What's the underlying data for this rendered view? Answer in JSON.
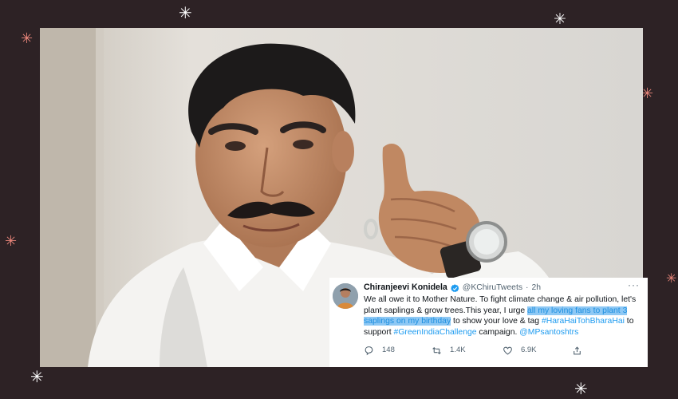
{
  "tweet": {
    "name": "Chiranjeevi Konidela",
    "handle": "@KChiruTweets",
    "separator": "·",
    "time": "2h",
    "more": "···",
    "text": {
      "part1": "We all owe it to Mother Nature. To fight climate change & air pollution, let's plant saplings & grow trees.This year, I urge ",
      "highlight": "all my loving fans to plant 3 saplings on my birthday",
      "part2": " to show your love & tag ",
      "hashtag1": "#HaraHaiTohBharaHai",
      "part3": " to support ",
      "hashtag2": "#GreenIndiaChallenge",
      "part4": " campaign. ",
      "mention": "@MPsantoshtrs"
    },
    "stats": {
      "replies": "148",
      "retweets": "1.4K",
      "likes": "6.9K"
    },
    "colors": {
      "link": "#1d9bf0",
      "highlight_bg": "#8ec8f4",
      "verified": "#1d9bf0"
    }
  },
  "background": {
    "color": "#2d2225",
    "sparkle_colors": [
      "#ffffff",
      "#e8857a"
    ]
  }
}
